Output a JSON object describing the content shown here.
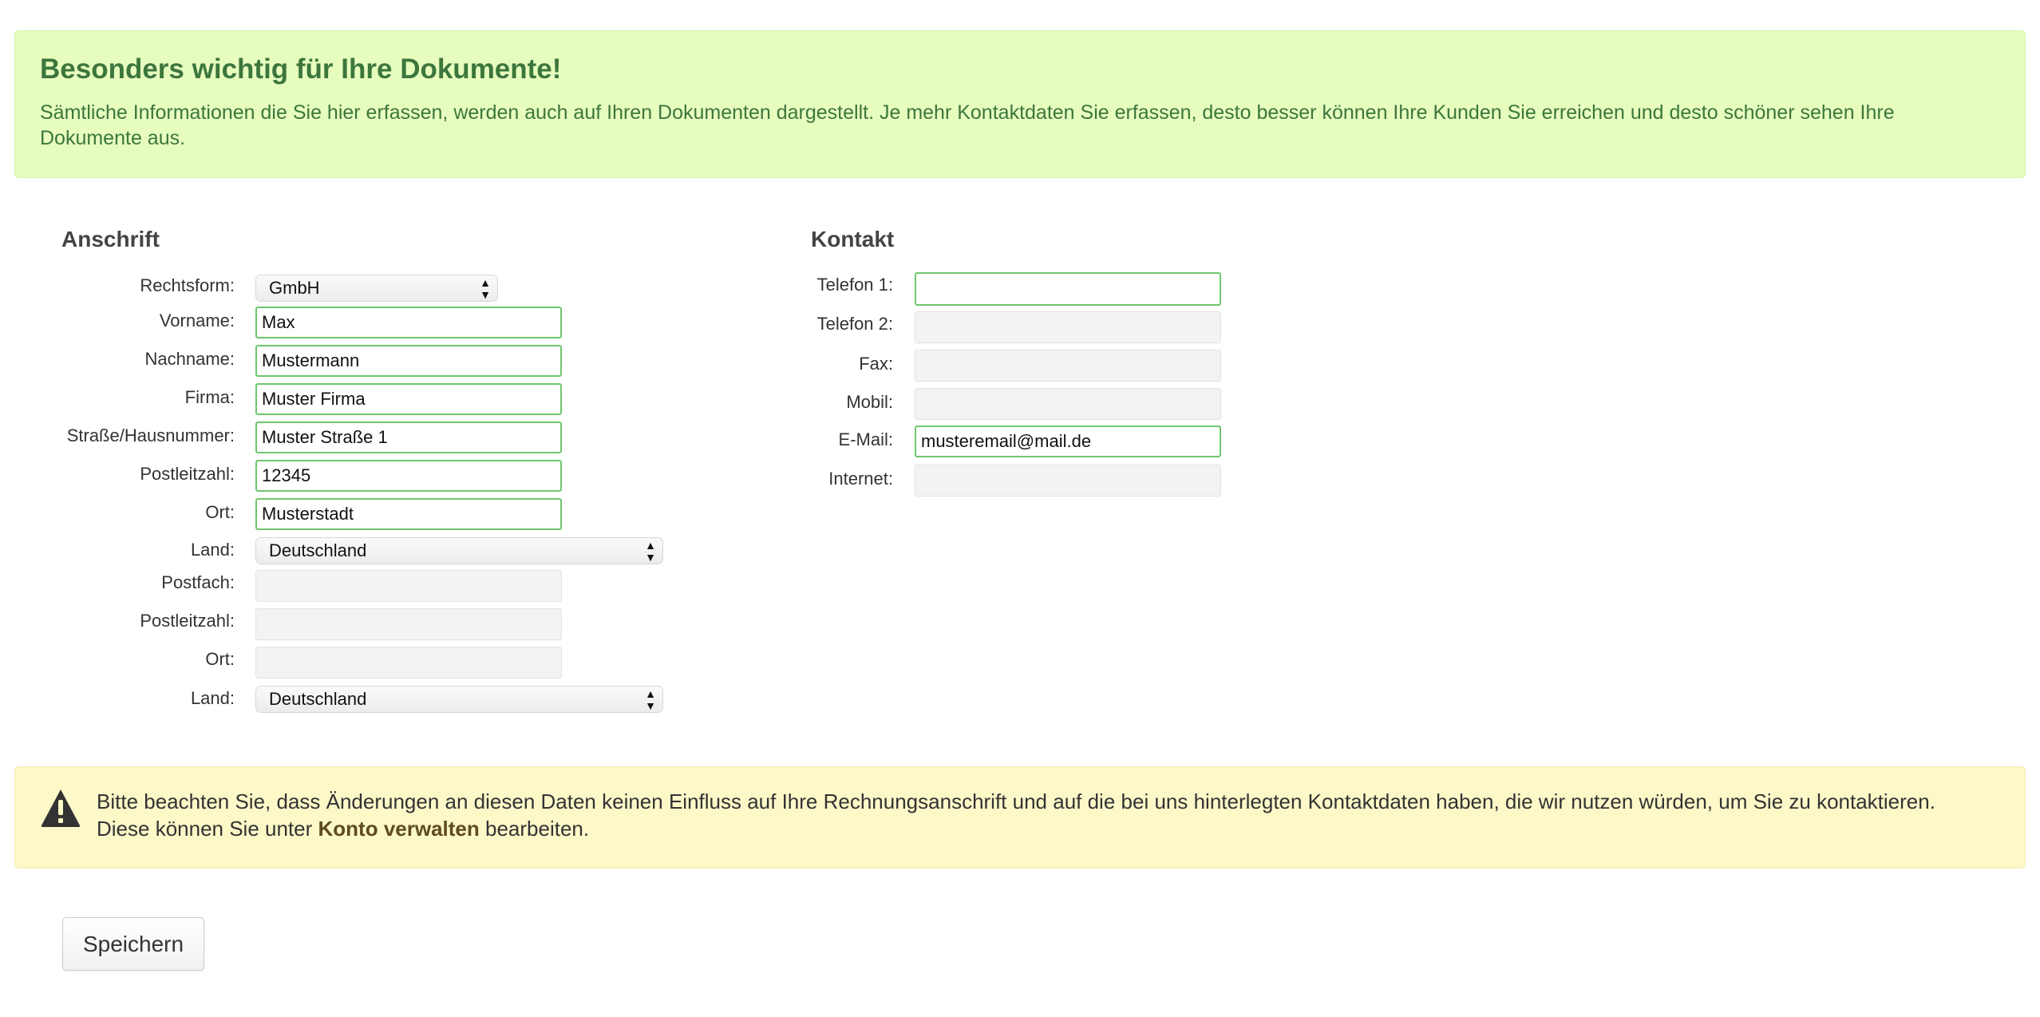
{
  "info": {
    "title": "Besonders wichtig für Ihre Dokumente!",
    "text": "Sämtliche Informationen die Sie hier erfassen, werden auch auf Ihren Dokumenten dargestellt. Je mehr Kontaktdaten Sie erfassen, desto besser können Ihre Kunden Sie erreichen und desto schöner sehen Ihre Dokumente aus."
  },
  "address": {
    "heading": "Anschrift",
    "rechtsform": {
      "label": "Rechtsform:",
      "value": "GmbH"
    },
    "vorname": {
      "label": "Vorname:",
      "value": "Max"
    },
    "nachname": {
      "label": "Nachname:",
      "value": "Mustermann"
    },
    "firma": {
      "label": "Firma:",
      "value": "Muster Firma"
    },
    "strasse": {
      "label": "Straße/Hausnummer:",
      "value": "Muster Straße 1"
    },
    "plz": {
      "label": "Postleitzahl:",
      "value": "12345"
    },
    "ort": {
      "label": "Ort:",
      "value": "Musterstadt"
    },
    "land": {
      "label": "Land:",
      "value": "Deutschland"
    },
    "postfach": {
      "label": "Postfach:",
      "value": ""
    },
    "postfach_plz": {
      "label": "Postleitzahl:",
      "value": ""
    },
    "postfach_ort": {
      "label": "Ort:",
      "value": ""
    },
    "postfach_land": {
      "label": "Land:",
      "value": "Deutschland"
    }
  },
  "contact": {
    "heading": "Kontakt",
    "telefon1": {
      "label": "Telefon 1:",
      "value": ""
    },
    "telefon2": {
      "label": "Telefon 2:",
      "value": ""
    },
    "fax": {
      "label": "Fax:",
      "value": ""
    },
    "mobil": {
      "label": "Mobil:",
      "value": ""
    },
    "email": {
      "label": "E-Mail:",
      "value": "musteremail@mail.de"
    },
    "internet": {
      "label": "Internet:",
      "value": ""
    }
  },
  "warning": {
    "text_before": "Bitte beachten Sie, dass Änderungen an diesen Daten keinen Einfluss auf Ihre Rechnungsanschrift und auf die bei uns hinterlegten Kontaktdaten haben, die wir nutzen würden, um Sie zu kontaktieren. Diese können Sie unter ",
    "link": "Konto verwalten",
    "text_after": " bearbeiten."
  },
  "save_label": "Speichern",
  "colors": {
    "info_bg": "#e6fdbe",
    "info_text": "#3c763d",
    "warning_bg": "#fcf8c8",
    "input_focus_border": "#6ec76e"
  }
}
